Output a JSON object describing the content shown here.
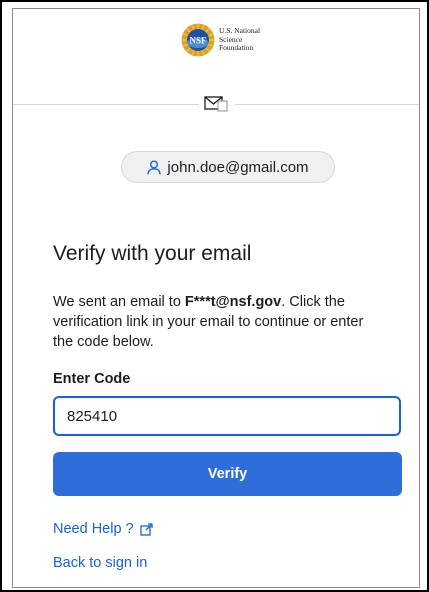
{
  "logo": {
    "seal_text": "NSF",
    "line1": "U.S. National",
    "line2": "Science",
    "line3": "Foundation"
  },
  "identifier": {
    "icon": "user-icon",
    "email": "john.doe@gmail.com"
  },
  "mail_icon": "mail-icon",
  "title": "Verify with your email",
  "description": {
    "prefix": "We sent an email to ",
    "masked_email": "F***t@nsf.gov",
    "suffix": ". Click the verification link in your email to continue or enter the code below."
  },
  "form": {
    "code_label": "Enter Code",
    "code_value": "825410",
    "verify_label": "Verify"
  },
  "links": {
    "help": "Need Help ?",
    "help_icon": "external-link-icon",
    "back": "Back to sign in"
  },
  "colors": {
    "primary": "#2f6ed9",
    "link": "#1662dd",
    "input_border": "#1662dd",
    "pill_bg": "#f0f0f3"
  }
}
